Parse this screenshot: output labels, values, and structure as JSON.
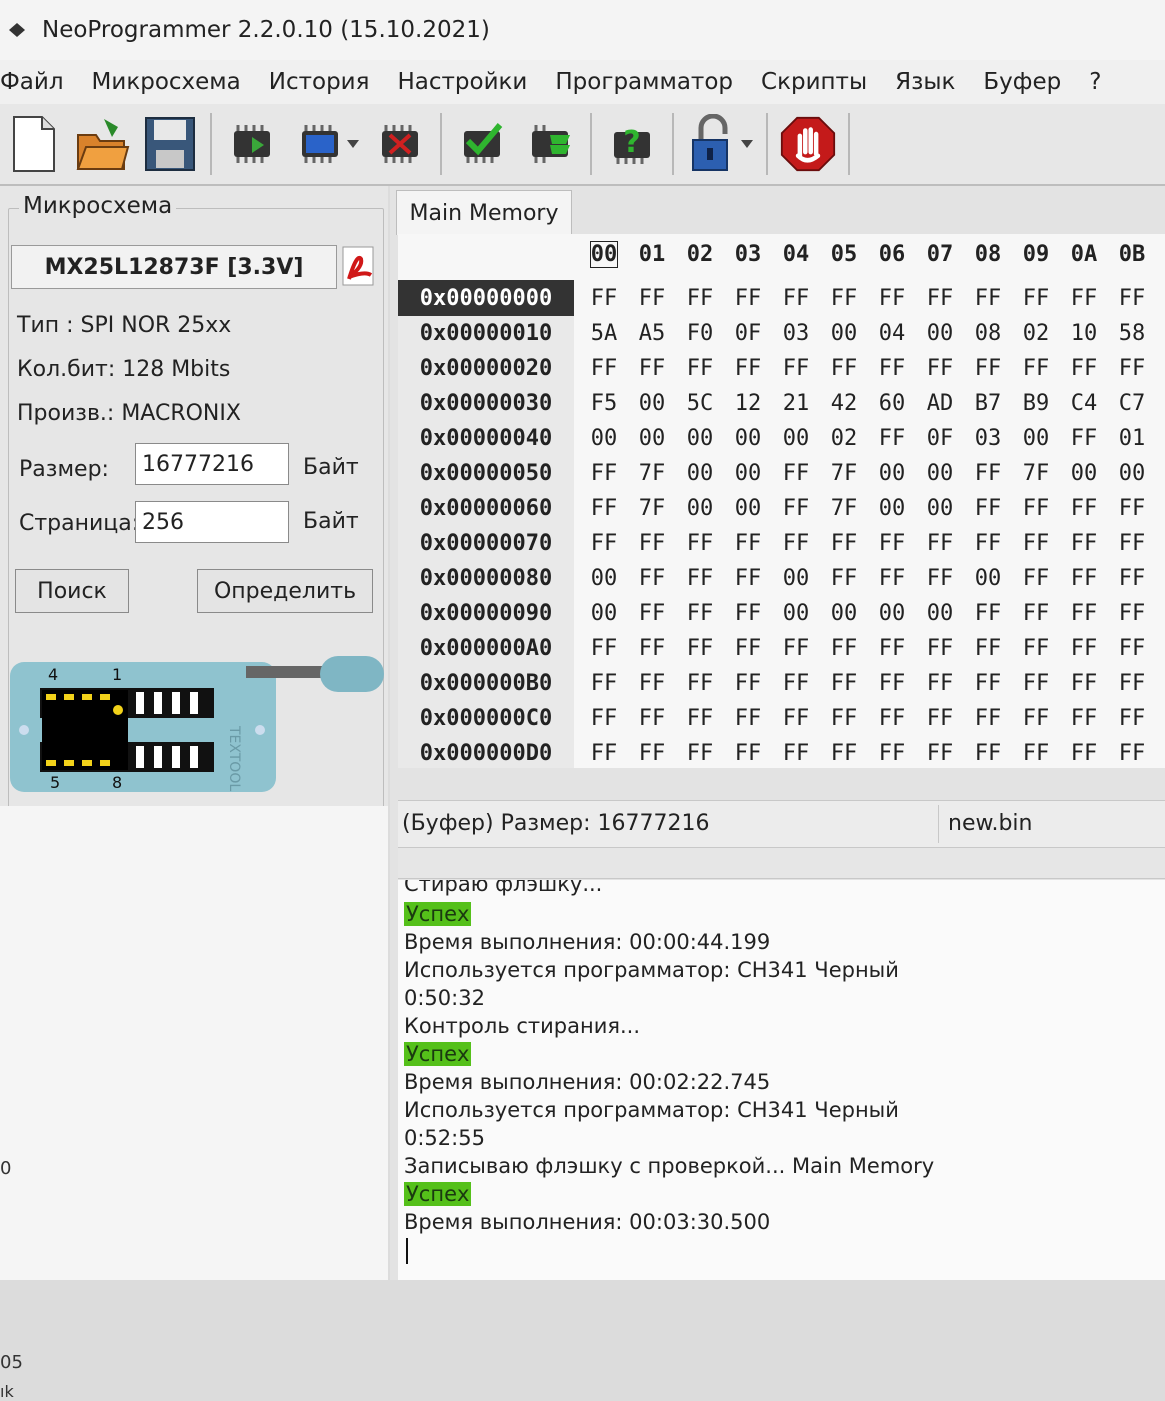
{
  "window": {
    "title": "NeoProgrammer 2.2.0.10 (15.10.2021)"
  },
  "menu": [
    "Файл",
    "Микросхема",
    "История",
    "Настройки",
    "Программатор",
    "Скрипты",
    "Язык",
    "Буфер",
    "?"
  ],
  "toolbar": {
    "icons": [
      "new-file-icon",
      "open-folder-icon",
      "save-disk-icon",
      "read-chip-icon",
      "write-chip-icon",
      "erase-chip-icon",
      "verify-chip-icon",
      "auto-chip-icon",
      "detect-chip-icon",
      "lock-icon",
      "stop-hand-icon"
    ]
  },
  "chip": {
    "group_title": "Микросхема",
    "name": "MX25L12873F [3.3V]",
    "type_label": "Тип       : SPI NOR 25xx",
    "bits_label": "Кол.бит: 128 Mbits",
    "vendor_label": "Произв.: MACRONIX",
    "size_label": "Размер:",
    "size_value": "16777216",
    "size_unit": "Байт",
    "page_label": "Страница:",
    "page_value": "256",
    "page_unit": "Байт",
    "search_button": "Поиск",
    "detect_button": "Определить",
    "socket": {
      "pin4": "4",
      "pin1": "1",
      "pin5": "5",
      "pin8": "8",
      "brand": "TEXTOOL"
    }
  },
  "left_edge": {
    "a": "0",
    "b": "05",
    "c": "ık"
  },
  "hex": {
    "tab_label": "Main Memory",
    "columns": [
      "00",
      "01",
      "02",
      "03",
      "04",
      "05",
      "06",
      "07",
      "08",
      "09",
      "0A",
      "0B"
    ],
    "rows": [
      {
        "addr": "0x00000000",
        "bytes": [
          "FF",
          "FF",
          "FF",
          "FF",
          "FF",
          "FF",
          "FF",
          "FF",
          "FF",
          "FF",
          "FF",
          "FF"
        ]
      },
      {
        "addr": "0x00000010",
        "bytes": [
          "5A",
          "A5",
          "F0",
          "0F",
          "03",
          "00",
          "04",
          "00",
          "08",
          "02",
          "10",
          "58"
        ]
      },
      {
        "addr": "0x00000020",
        "bytes": [
          "FF",
          "FF",
          "FF",
          "FF",
          "FF",
          "FF",
          "FF",
          "FF",
          "FF",
          "FF",
          "FF",
          "FF"
        ]
      },
      {
        "addr": "0x00000030",
        "bytes": [
          "F5",
          "00",
          "5C",
          "12",
          "21",
          "42",
          "60",
          "AD",
          "B7",
          "B9",
          "C4",
          "C7"
        ]
      },
      {
        "addr": "0x00000040",
        "bytes": [
          "00",
          "00",
          "00",
          "00",
          "00",
          "02",
          "FF",
          "0F",
          "03",
          "00",
          "FF",
          "01"
        ]
      },
      {
        "addr": "0x00000050",
        "bytes": [
          "FF",
          "7F",
          "00",
          "00",
          "FF",
          "7F",
          "00",
          "00",
          "FF",
          "7F",
          "00",
          "00"
        ]
      },
      {
        "addr": "0x00000060",
        "bytes": [
          "FF",
          "7F",
          "00",
          "00",
          "FF",
          "7F",
          "00",
          "00",
          "FF",
          "FF",
          "FF",
          "FF"
        ]
      },
      {
        "addr": "0x00000070",
        "bytes": [
          "FF",
          "FF",
          "FF",
          "FF",
          "FF",
          "FF",
          "FF",
          "FF",
          "FF",
          "FF",
          "FF",
          "FF"
        ]
      },
      {
        "addr": "0x00000080",
        "bytes": [
          "00",
          "FF",
          "FF",
          "FF",
          "00",
          "FF",
          "FF",
          "FF",
          "00",
          "FF",
          "FF",
          "FF"
        ]
      },
      {
        "addr": "0x00000090",
        "bytes": [
          "00",
          "FF",
          "FF",
          "FF",
          "00",
          "00",
          "00",
          "00",
          "FF",
          "FF",
          "FF",
          "FF"
        ]
      },
      {
        "addr": "0x000000A0",
        "bytes": [
          "FF",
          "FF",
          "FF",
          "FF",
          "FF",
          "FF",
          "FF",
          "FF",
          "FF",
          "FF",
          "FF",
          "FF"
        ]
      },
      {
        "addr": "0x000000B0",
        "bytes": [
          "FF",
          "FF",
          "FF",
          "FF",
          "FF",
          "FF",
          "FF",
          "FF",
          "FF",
          "FF",
          "FF",
          "FF"
        ]
      },
      {
        "addr": "0x000000C0",
        "bytes": [
          "FF",
          "FF",
          "FF",
          "FF",
          "FF",
          "FF",
          "FF",
          "FF",
          "FF",
          "FF",
          "FF",
          "FF"
        ]
      },
      {
        "addr": "0x000000D0",
        "bytes": [
          "FF",
          "FF",
          "FF",
          "FF",
          "FF",
          "FF",
          "FF",
          "FF",
          "FF",
          "FF",
          "FF",
          "FF"
        ]
      }
    ]
  },
  "status": {
    "buffer_size": "(Буфер) Размер: 16777216",
    "file_name": "new.bin"
  },
  "log": {
    "l0": "Стираю флэшку...",
    "l1": "Успех",
    "l2": "Время выполнения: 00:00:44.199",
    "l3": "Используется программатор: CH341 Черный",
    "l4": "0:50:32",
    "l5": "Контроль стирания...",
    "l6": "Успех",
    "l7": "Время выполнения: 00:02:22.745",
    "l8": "Используется программатор: CH341 Черный",
    "l9": "0:52:55",
    "l10": "Записываю флэшку с проверкой... Main Memory",
    "l11": "Успех",
    "l12": "Время выполнения: 00:03:30.500"
  },
  "colors": {
    "success": "#55c01a",
    "selected_addr": "#333333"
  }
}
